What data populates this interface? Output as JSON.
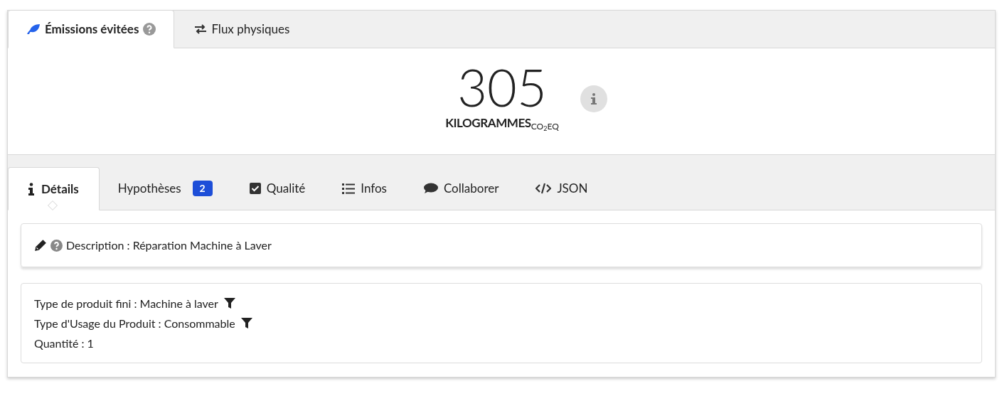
{
  "top_tabs": [
    {
      "label": "Émissions évitées",
      "kind": "leaf",
      "help": true,
      "selected": true
    },
    {
      "label": "Flux physiques",
      "kind": "exchange",
      "help": false,
      "selected": false
    }
  ],
  "result": {
    "value": "305",
    "unit": "KILOGRAMMES",
    "unit_suffix": "CO$_{2}$EQ"
  },
  "detail_tabs": [
    {
      "label": "Détails",
      "kind": "info",
      "selected": true
    },
    {
      "label": "Hypothèses",
      "kind": "none",
      "badge": "2",
      "selected": false
    },
    {
      "label": "Qualité",
      "kind": "check",
      "selected": false
    },
    {
      "label": "Infos",
      "kind": "list",
      "selected": false
    },
    {
      "label": "Collaborer",
      "kind": "comment",
      "selected": false
    },
    {
      "label": "JSON",
      "kind": "code",
      "selected": false
    }
  ],
  "description": "Description : Réparation Machine à Laver",
  "properties": [
    {
      "text": "Type de produit fini : Machine à laver",
      "filter": true
    },
    {
      "text": "Type d'Usage du Produit : Consommable",
      "filter": true
    },
    {
      "text": "Quantité : 1",
      "filter": false
    }
  ]
}
